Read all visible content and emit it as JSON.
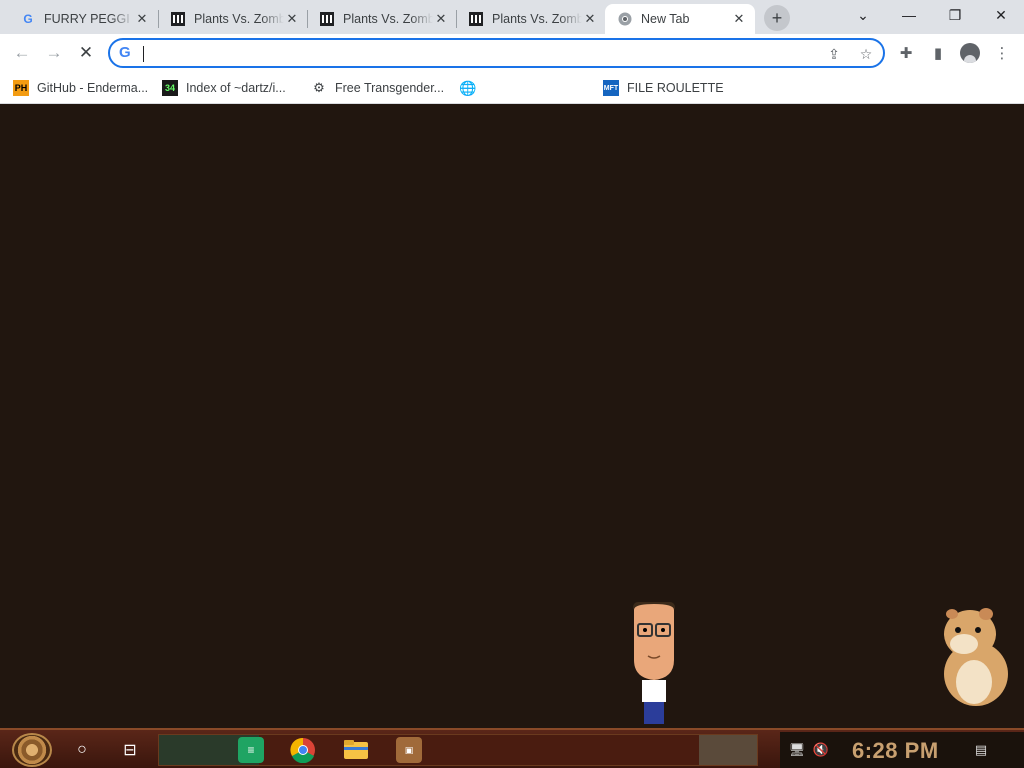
{
  "tabs": [
    {
      "title": "FURRY PEGGI",
      "icon": "google-g-icon",
      "active": false
    },
    {
      "title": "Plants Vs. Zombies",
      "icon": "museum-icon",
      "active": false
    },
    {
      "title": "Plants Vs. Zombies",
      "icon": "museum-icon",
      "active": false
    },
    {
      "title": "Plants Vs. Zombies",
      "icon": "museum-icon",
      "active": false
    },
    {
      "title": "New Tab",
      "icon": "chrome-icon",
      "active": true
    }
  ],
  "omnibox": {
    "value": "",
    "placeholder": ""
  },
  "bookmarks": [
    {
      "label": "GitHub - Enderma...",
      "icon": "PH"
    },
    {
      "label": "Index of ~dartz/i...",
      "icon": "34"
    },
    {
      "label": "Free Transgender...",
      "icon": "robot"
    },
    {
      "label": "",
      "icon": "globe"
    },
    {
      "label": "FILE ROULETTE",
      "icon": "MFT"
    }
  ],
  "taskbar": {
    "clock": "6:28 PM",
    "apps": [
      "start-orb",
      "search",
      "task-view",
      "notes",
      "chrome",
      "file-explorer",
      "game-app"
    ]
  },
  "colors": {
    "content_bg": "#21160f",
    "accent": "#1a73e8",
    "clock": "#c8a070"
  }
}
